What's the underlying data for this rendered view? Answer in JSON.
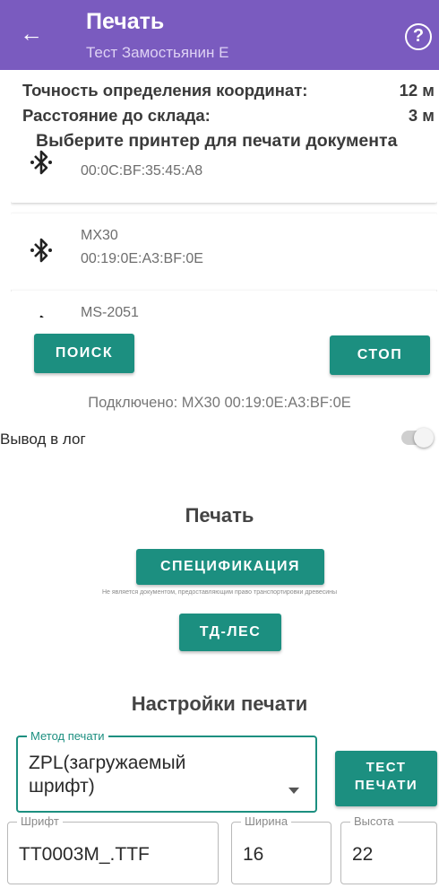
{
  "appbar": {
    "title": "Печать",
    "subtitle": "Тест Замостьянин Е",
    "back_icon": "arrow-back-icon",
    "help_icon": "help-circle-icon",
    "help_glyph": "?",
    "color": "#7a5bbf"
  },
  "info": {
    "accuracy_label": "Точность определения координат:",
    "accuracy_value": "12 м",
    "distance_label": "Расстояние до склада:",
    "distance_value": "3 м"
  },
  "printer_prompt": "Выберите принтер для печати документа",
  "devices": [
    {
      "name": "",
      "address": "00:0C:BF:35:45:A8",
      "icon": "bluetooth-icon"
    },
    {
      "name": "MX30",
      "address": "00:19:0E:A3:BF:0E",
      "icon": "bluetooth-icon"
    },
    {
      "name": "MS-2051",
      "address": "",
      "icon": "bluetooth-icon"
    }
  ],
  "buttons": {
    "search": "ПОИСК",
    "stop": "СТОП",
    "spec": "СПЕЦИФИКАЦИЯ",
    "td_les": "ТД-ЛЕС",
    "test_print_line1": "ТЕСТ",
    "test_print_line2": "ПЕЧАТИ"
  },
  "connected_text": "Подключено: MX30 00:19:0E:A3:BF:0E",
  "log_label": "Вывод в лог",
  "log_enabled": false,
  "print_section_title": "Печать",
  "spec_note": "Не является документом, предоставляющим право транспортировки древесины",
  "settings_title": "Настройки печати",
  "settings": {
    "method_label": "Метод печати",
    "method_value_line1": "ZPL(загружаемый",
    "method_value_line2": "шрифт)",
    "font_label": "Шрифт",
    "font_value": "TT0003M_.TTF",
    "width_label": "Ширина",
    "width_value": "16",
    "height_label": "Высота",
    "height_value": "22"
  },
  "accent_color": "#1c8f80"
}
